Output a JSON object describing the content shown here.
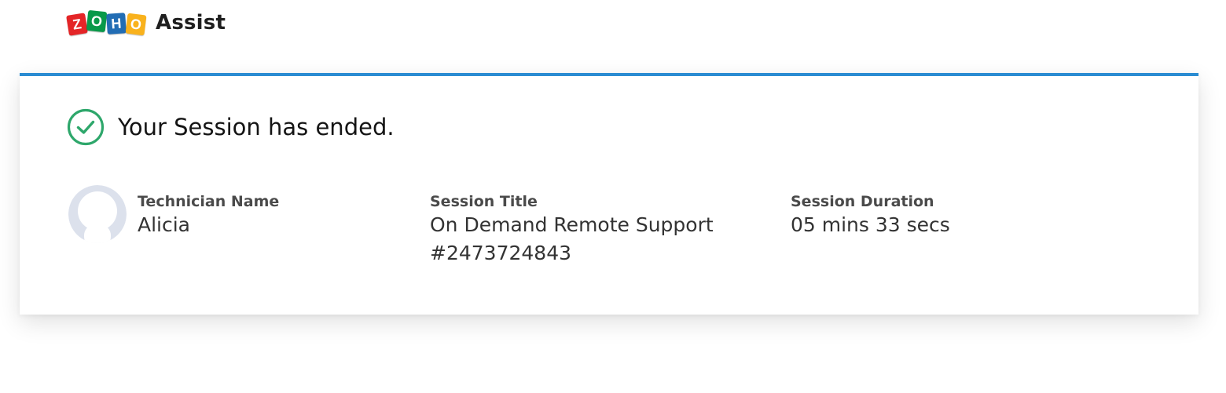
{
  "brand": {
    "logo_letters": [
      "Z",
      "O",
      "H",
      "O"
    ],
    "logo_colors": [
      "#E42527",
      "#089949",
      "#226DB4",
      "#F9B21D"
    ],
    "name": "Assist"
  },
  "session": {
    "status_message": "Your Session has ended.",
    "accent_color": "#2B8CD2",
    "success_color": "#2EA76B",
    "technician": {
      "label": "Technician Name",
      "value": "Alicia"
    },
    "title": {
      "label": "Session Title",
      "value_line1": "On Demand Remote Support",
      "value_line2": "#2473724843"
    },
    "duration": {
      "label": "Session Duration",
      "value": "05 mins 33 secs"
    }
  },
  "icons": {
    "status": "check-circle-icon",
    "avatar": "user-avatar-icon"
  }
}
